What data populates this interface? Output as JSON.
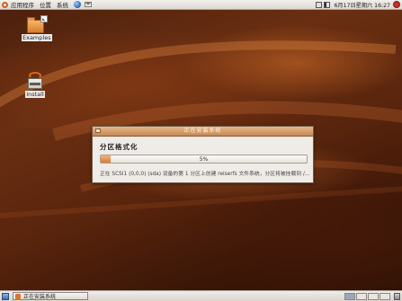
{
  "top_panel": {
    "menus": [
      "应用程序",
      "位置",
      "系统"
    ],
    "clock": "6月17日星期六 16:27",
    "icons": [
      "ubuntu-logo",
      "globe-icon",
      "mail-icon",
      "network-icon",
      "volume-icon",
      "power-icon"
    ]
  },
  "desktop": {
    "icons": [
      {
        "label": "Examples",
        "icon": "folder-icon"
      },
      {
        "label": "Install",
        "icon": "installer-icon"
      }
    ]
  },
  "dialog": {
    "title": "正在安装系统",
    "step_title": "分区格式化",
    "progress_percent": 5,
    "progress_label": "5%",
    "status": "正在 SCSI1 (0,0,0) (sda) 设备的第 1 分区上创建 reiserfs 文件系统，分区将被挂载到 /..."
  },
  "bottom_panel": {
    "task_label": "正在安装系统",
    "workspaces": 4,
    "active_workspace": 1
  },
  "colors": {
    "accent": "#de7a34",
    "desktop_base": "#5a250d",
    "panel": "#e5e2dd"
  }
}
